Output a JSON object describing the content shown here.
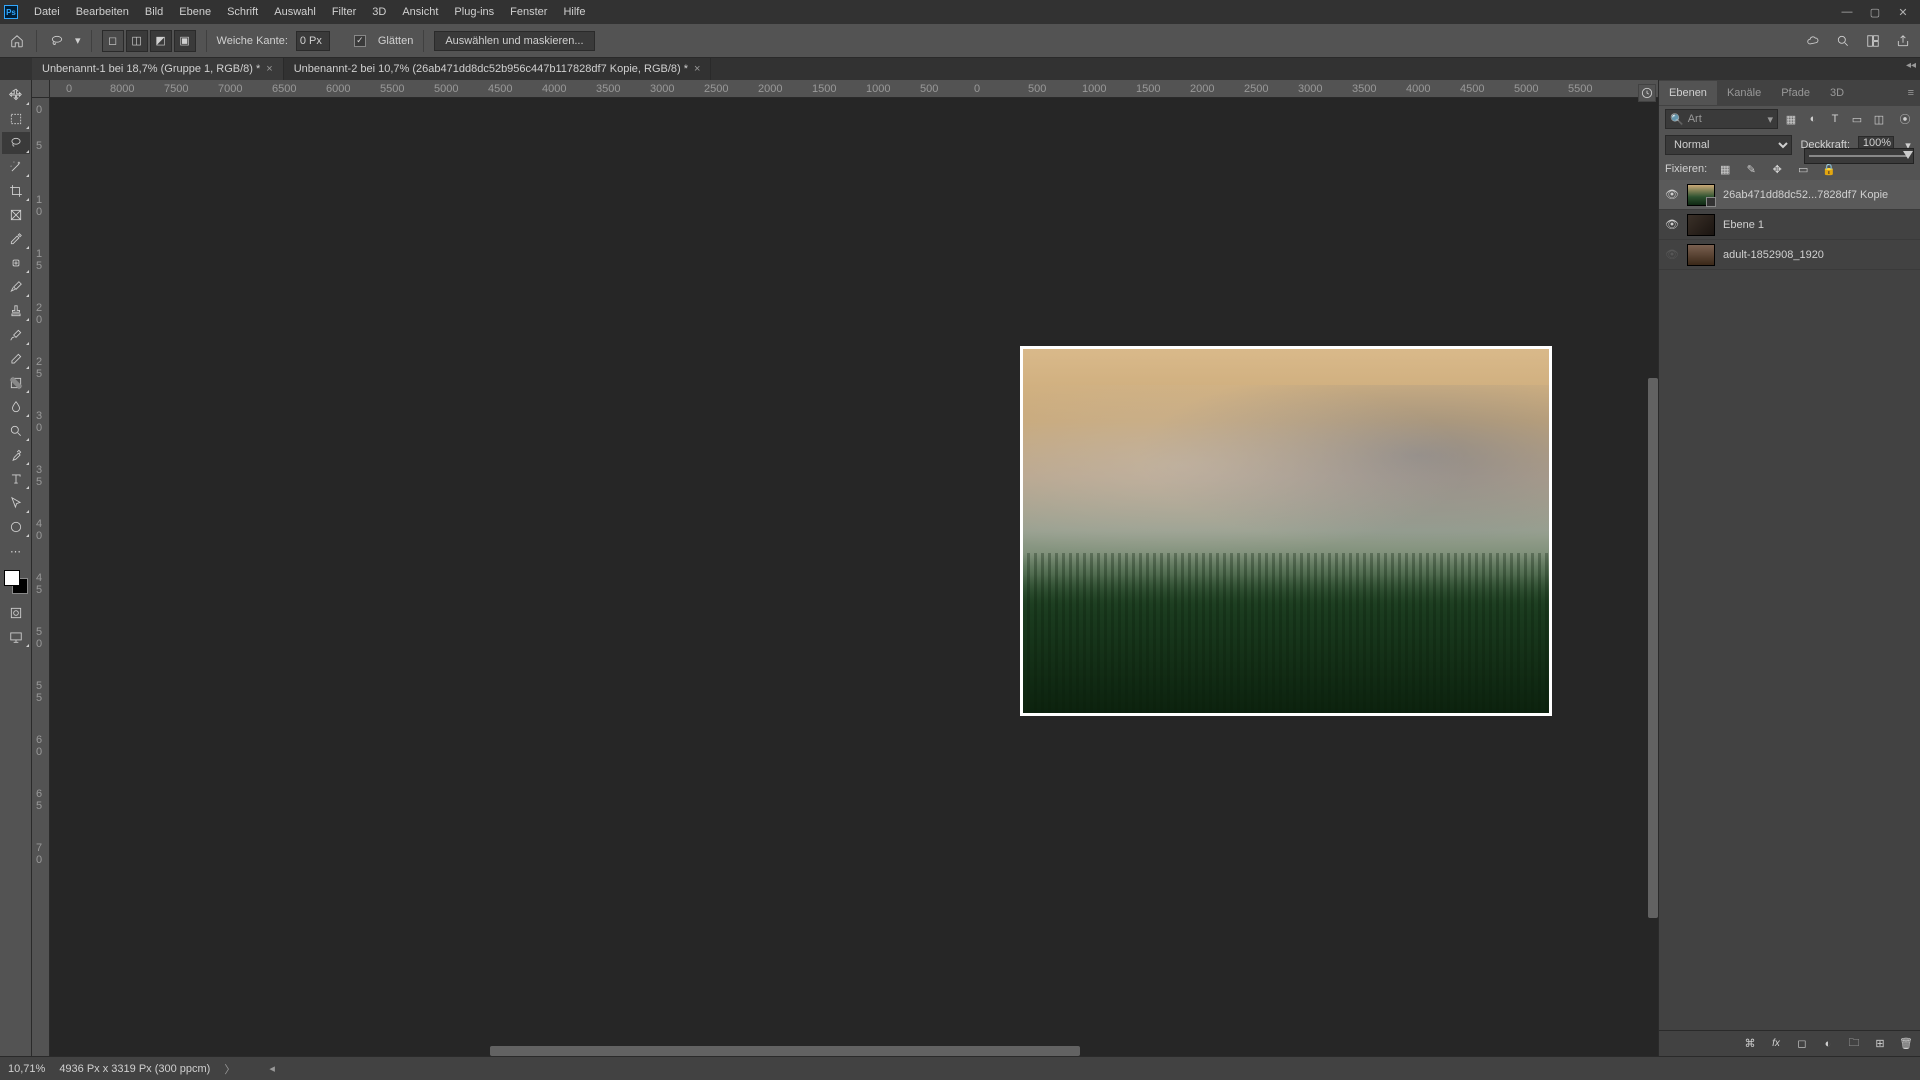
{
  "menubar": [
    "Datei",
    "Bearbeiten",
    "Bild",
    "Ebene",
    "Schrift",
    "Auswahl",
    "Filter",
    "3D",
    "Ansicht",
    "Plug-ins",
    "Fenster",
    "Hilfe"
  ],
  "optionsbar": {
    "feather_label": "Weiche Kante:",
    "feather_value": "0 Px",
    "antialias_label": "Glätten",
    "mask_button": "Auswählen und maskieren..."
  },
  "tabs": [
    {
      "title": "Unbenannt-1 bei 18,7% (Gruppe 1, RGB/8) *",
      "active": false
    },
    {
      "title": "Unbenannt-2 bei 10,7% (26ab471dd8dc52b956c447b117828df7 Kopie, RGB/8) *",
      "active": true
    }
  ],
  "ruler_h": [
    "0",
    "8000",
    "7500",
    "7000",
    "6500",
    "6000",
    "5500",
    "5000",
    "4500",
    "4000",
    "3500",
    "3000",
    "2500",
    "2000",
    "1500",
    "1000",
    "500",
    "0",
    "500",
    "1000",
    "1500",
    "2000",
    "2500",
    "3000",
    "3500",
    "4000",
    "4500",
    "5000",
    "5500"
  ],
  "ruler_v": [
    "0",
    "5",
    "1",
    "0",
    "1",
    "5",
    "2",
    "0",
    "2",
    "5",
    "3",
    "0",
    "3",
    "5",
    "4",
    "0",
    "4",
    "5",
    "5",
    "0",
    "5",
    "5",
    "6",
    "0",
    "6",
    "5",
    "7",
    "0"
  ],
  "panel": {
    "tabs": [
      "Ebenen",
      "Kanäle",
      "Pfade",
      "3D"
    ],
    "active_tab_index": 0,
    "filter_label": "Art",
    "blend_mode": "Normal",
    "opacity_label": "Deckkraft:",
    "opacity_value": "100%",
    "lock_label": "Fixieren:",
    "opacity_slider": 100
  },
  "layers": [
    {
      "visible": true,
      "name": "26ab471dd8dc52...7828df7 Kopie",
      "selected": true,
      "smart": true,
      "thumb": "forest"
    },
    {
      "visible": true,
      "name": "Ebene 1",
      "selected": false,
      "smart": false,
      "thumb": "dark"
    },
    {
      "visible": false,
      "name": "adult-1852908_1920",
      "selected": false,
      "smart": false,
      "thumb": "photo"
    }
  ],
  "statusbar": {
    "zoom": "10,71%",
    "doc_info": "4936 Px x 3319 Px (300 ppcm)"
  }
}
